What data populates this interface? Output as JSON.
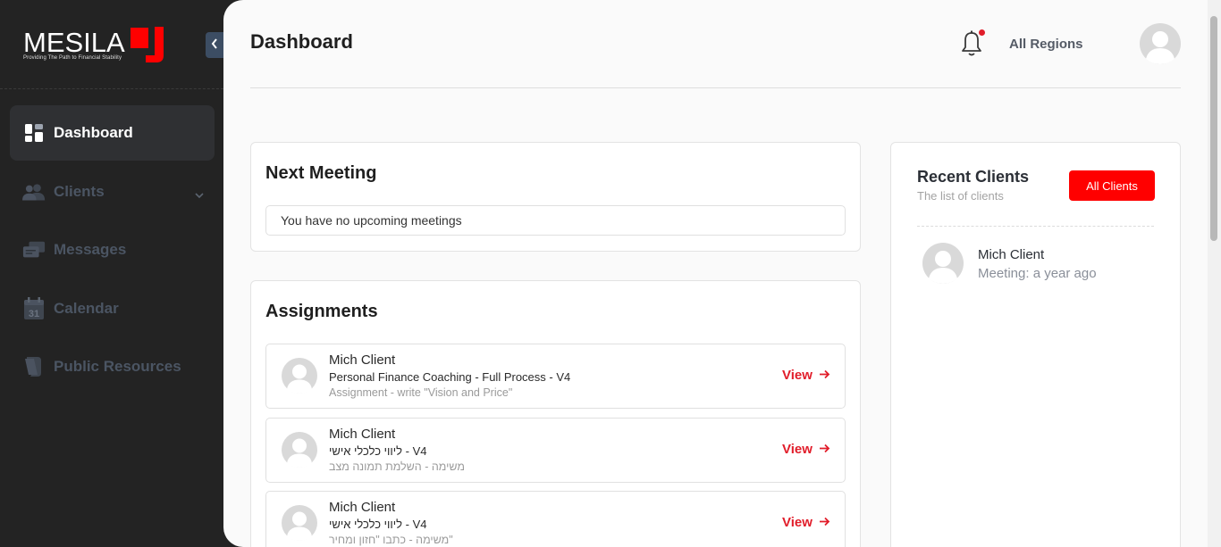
{
  "brand": {
    "name": "MESILA",
    "tagline": "Providing The Path to Financial Stability",
    "accent": "#e11d2a"
  },
  "sidebar": {
    "items": [
      {
        "label": "Dashboard",
        "icon": "dashboard-icon",
        "active": true
      },
      {
        "label": "Clients",
        "icon": "users-icon",
        "has_submenu": true
      },
      {
        "label": "Messages",
        "icon": "messages-icon"
      },
      {
        "label": "Calendar",
        "icon": "calendar-icon",
        "icon_text": "31"
      },
      {
        "label": "Public Resources",
        "icon": "resources-icon"
      }
    ]
  },
  "header": {
    "title": "Dashboard",
    "region": "All Regions",
    "has_notification": true
  },
  "next_meeting": {
    "title": "Next Meeting",
    "empty_text": "You have no upcoming meetings"
  },
  "assignments": {
    "title": "Assignments",
    "view_label": "View",
    "items": [
      {
        "client": "Mich Client",
        "course": "Personal Finance Coaching - Full Process - V4",
        "task": "Assignment - write \"Vision and Price\""
      },
      {
        "client": "Mich Client",
        "course": "ליווי כלכלי אישי - V4",
        "task": "משימה - השלמת תמונה מצב"
      },
      {
        "client": "Mich Client",
        "course": "ליווי כלכלי אישי - V4",
        "task": "משימה - כתבו \"חזון ומחיר\""
      }
    ]
  },
  "recent_clients": {
    "title": "Recent Clients",
    "subtitle": "The list of clients",
    "button": "All Clients",
    "items": [
      {
        "name": "Mich Client",
        "meta": "Meeting: a year ago"
      }
    ]
  }
}
